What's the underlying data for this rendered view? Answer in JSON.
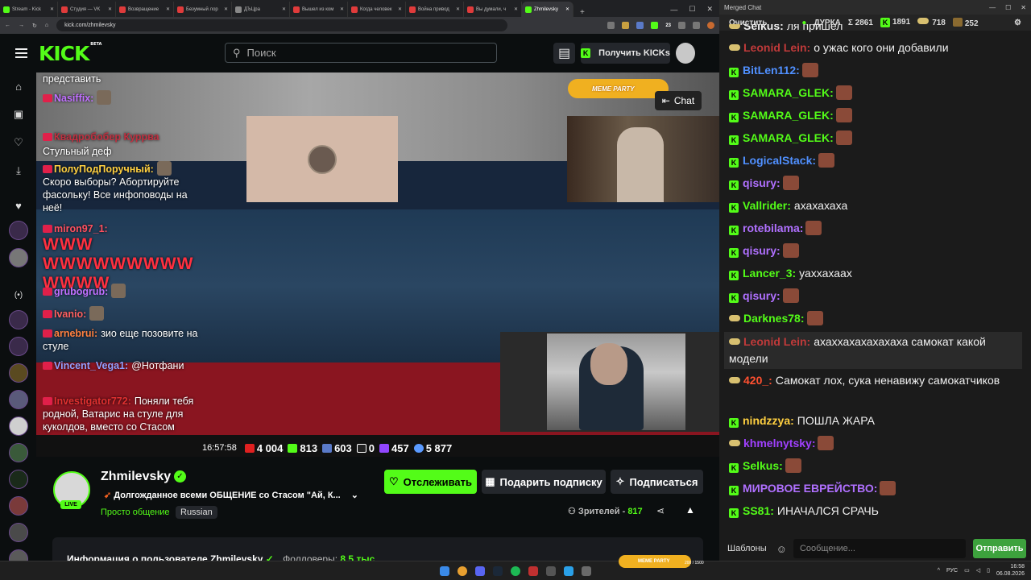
{
  "browser": {
    "tabs": [
      {
        "label": "Stream - Kick",
        "color": "#53fc18"
      },
      {
        "label": "Студия — VK",
        "color": "#e03b3b"
      },
      {
        "label": "Возвращение",
        "color": "#e03b3b"
      },
      {
        "label": "Безумный лор",
        "color": "#e03b3b"
      },
      {
        "label": "ДЪЦра",
        "color": "#888888"
      },
      {
        "label": "Вышел из ком",
        "color": "#e03b3b"
      },
      {
        "label": "Когда человек",
        "color": "#e03b3b"
      },
      {
        "label": "Война привод",
        "color": "#e03b3b"
      },
      {
        "label": "Вы думали, ч",
        "color": "#e03b3b"
      },
      {
        "label": "Zhmilevsky",
        "color": "#53fc18"
      }
    ],
    "url": "kick.com/zhmilevsky",
    "ext_count": "23"
  },
  "kick": {
    "logo": "KICK",
    "logo_beta": "BETA",
    "search_placeholder": "Поиск",
    "get_kicks": "Получить KICKs"
  },
  "video": {
    "meme_party": "MEME PARTY",
    "chat_button": "Chat",
    "overlay_chat": [
      {
        "user": "",
        "text": "представить",
        "color": "#ffffff"
      },
      {
        "user": "Nasiffix:",
        "text": "",
        "color": "#c070ff"
      },
      {
        "user": "Квадробобер Куррва",
        "text": "",
        "color": "#c03040"
      },
      {
        "user": "",
        "text": "Стульный деф",
        "color": "#ffffff"
      },
      {
        "user": "ПолуПодПоручный:",
        "text": "",
        "color": "#ffd040"
      },
      {
        "user": "",
        "text": "Скоро выборы? Абортируйте фасольку! Все инфоповоды на неё!",
        "color": "#ffffff"
      },
      {
        "user": "miron97_1:",
        "text": "WWW WWWWWWWWW WWWW",
        "color": "#ff5060"
      },
      {
        "user": "grubogrub:",
        "text": "",
        "color": "#c070ff"
      },
      {
        "user": "Ivanio:",
        "text": "",
        "color": "#ff6060"
      },
      {
        "user": "arnebrui:",
        "text": "зио еще позовите на стуле",
        "color": "#ff8040"
      },
      {
        "user": "Vincent_Vega1:",
        "text": "@Нотфани",
        "color": "#90a0ff"
      },
      {
        "user": "Investigator772:",
        "text": "Поняли тебя родной, Ватарис на стуле для куколдов, вместо со Стасом",
        "color": "#e03030"
      }
    ],
    "stats": {
      "time": "16:57:58",
      "youtube": "4 004",
      "kick": "813",
      "vk": "603",
      "rutube": "0",
      "twitch": "457",
      "total": "5 877"
    }
  },
  "streamer": {
    "name": "Zhmilevsky",
    "live_badge": "LIVE",
    "title": "Долгожданное всеми ОБЩЕНИЕ со Стасом \"Ай, К...",
    "category": "Просто общение",
    "language": "Russian",
    "follow": "Отслеживать",
    "gift_sub": "Подарить подписку",
    "subscribe": "Подписаться",
    "viewers_label": "Зрителей -",
    "viewers_count": "817",
    "about": "Информация о пользователе Zhmilevsky",
    "followers_label": "Фолловеры:",
    "followers_value": "8,5 тыс."
  },
  "chat_panel": {
    "window_title": "Merged Chat",
    "clear": "Очистить",
    "dura": "ДУРКА",
    "sum_label": "Σ 2861",
    "kick_count": "1891",
    "yt_count": "718",
    "other_count": "252",
    "templates": "Шаблоны",
    "input_placeholder": "Сообщение...",
    "send": "Отправить",
    "messages": [
      {
        "platform": "twitch",
        "user": "Selkus:",
        "text": "ля пришел",
        "color": "#f0f0f0",
        "emote": false
      },
      {
        "platform": "twitch",
        "user": "Leonid Lein:",
        "text": "о ужас кого они добавили",
        "color": "#c03a3a",
        "emote": false
      },
      {
        "platform": "kick",
        "user": "BitLen112:",
        "text": "",
        "color": "#5090ff",
        "emote": true
      },
      {
        "platform": "kick",
        "user": "SAMARA_GLEK:",
        "text": "",
        "color": "#53fc18",
        "emote": true
      },
      {
        "platform": "kick",
        "user": "SAMARA_GLEK:",
        "text": "",
        "color": "#53fc18",
        "emote": true
      },
      {
        "platform": "kick",
        "user": "SAMARA_GLEK:",
        "text": "",
        "color": "#53fc18",
        "emote": true
      },
      {
        "platform": "kick",
        "user": "LogicalStack:",
        "text": "",
        "color": "#5090ff",
        "emote": true
      },
      {
        "platform": "kick",
        "user": "qisury:",
        "text": "",
        "color": "#b070ff",
        "emote": true
      },
      {
        "platform": "kick",
        "user": "Vallrider:",
        "text": "ахахахаха",
        "color": "#53fc18",
        "emote": false
      },
      {
        "platform": "kick",
        "user": "rotebilama:",
        "text": "",
        "color": "#b070ff",
        "emote": true
      },
      {
        "platform": "kick",
        "user": "qisury:",
        "text": "",
        "color": "#b070ff",
        "emote": true
      },
      {
        "platform": "kick",
        "user": "Lancer_3:",
        "text": "уаххахаах",
        "color": "#53fc18",
        "emote": false
      },
      {
        "platform": "kick",
        "user": "qisury:",
        "text": "",
        "color": "#b070ff",
        "emote": true
      },
      {
        "platform": "twitch",
        "user": "Darknes78:",
        "text": "",
        "color": "#53fc18",
        "emote": true
      },
      {
        "platform": "twitch",
        "user": "Leonid Lein:",
        "text": "ахаххахахахахаха самокат какой модели",
        "color": "#c03a3a",
        "emote": false,
        "highlight": true
      },
      {
        "platform": "twitch",
        "user": "420_:",
        "text": "Самокат лох, сука ненавижу самокатчиков",
        "color": "#ff5030",
        "emote": false
      },
      {
        "platform": "kick",
        "user": "nindzzya:",
        "text": "ПОШЛА ЖАРА",
        "color": "#ffd040",
        "emote": false
      },
      {
        "platform": "twitch",
        "user": "khmelnytsky:",
        "text": "",
        "color": "#a040ff",
        "emote": true
      },
      {
        "platform": "kick",
        "user": "Selkus:",
        "text": "",
        "color": "#53fc18",
        "emote": true
      },
      {
        "platform": "kick",
        "user": "МИРОВОЕ ЕВРЕЙСТВО:",
        "text": "",
        "color": "#b070ff",
        "emote": true
      },
      {
        "platform": "kick",
        "user": "SS81:",
        "text": "ИНАЧАЛСЯ СРАЧЬ",
        "color": "#53fc18",
        "emote": false
      }
    ]
  },
  "taskbar": {
    "lang": "РУС",
    "time": "16:58",
    "date": "06.08.2026",
    "mini_overlay": "200 / 1500"
  }
}
